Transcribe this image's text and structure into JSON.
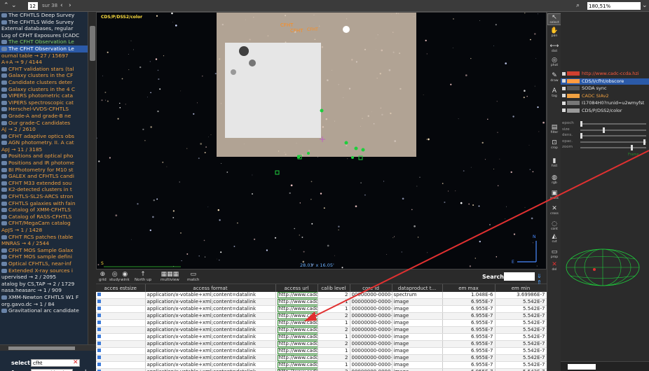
{
  "topbar": {
    "page": "12",
    "of_label": "sur 38",
    "zoom": "180,51%",
    "nav_icons": [
      "chevron-up",
      "chevron-down",
      "chevron-left",
      "chevron-right"
    ]
  },
  "tree": {
    "rows": [
      {
        "text": "The CFHTLS Deep Survey",
        "style": "t-white",
        "icon": true
      },
      {
        "text": "The CFHTLS Wide Survey",
        "style": "t-white",
        "icon": true
      },
      {
        "text": "External databases, regular",
        "style": "t-white",
        "icon": false
      },
      {
        "text": "Log of CFHT Exposures (CADC",
        "style": "t-white",
        "icon": false
      },
      {
        "text": "The CFHT Observation Le",
        "style": "t-green",
        "icon": true
      },
      {
        "text": "The CFHT Observation Le",
        "style": "t-sel",
        "icon": true
      },
      {
        "text": "ournal table → 27 / 15697",
        "style": "t-orange",
        "icon": false
      },
      {
        "text": "A+A → 9 / 4144",
        "style": "t-orange",
        "icon": false
      },
      {
        "text": "CFHT validation stars (tal",
        "style": "t-orange",
        "icon": true
      },
      {
        "text": "Galaxy clusters in the CF",
        "style": "t-orange",
        "icon": true
      },
      {
        "text": "Candidate clusters deter",
        "style": "t-orange",
        "icon": true
      },
      {
        "text": "Galaxy clusters in the 4 C",
        "style": "t-orange",
        "icon": true
      },
      {
        "text": "VIPERS photometric cata",
        "style": "t-orange",
        "icon": true
      },
      {
        "text": "VIPERS spectroscopic cat",
        "style": "t-orange",
        "icon": true
      },
      {
        "text": "Herschel-VVDS-CFHTLS",
        "style": "t-orange",
        "icon": true
      },
      {
        "text": "Grade-A and grade-B ne",
        "style": "t-orange",
        "icon": true
      },
      {
        "text": "Our grade-C candidates",
        "style": "t-orange",
        "icon": true
      },
      {
        "text": "AJ → 2 / 2610",
        "style": "t-orange",
        "icon": false
      },
      {
        "text": "CFHT adaptive optics obs",
        "style": "t-orange",
        "icon": true
      },
      {
        "text": "AGN photometry. II. A cat",
        "style": "t-orange",
        "icon": true
      },
      {
        "text": "ApJ → 11 / 3185",
        "style": "t-orange",
        "icon": false
      },
      {
        "text": "Positions and optical pho",
        "style": "t-orange",
        "icon": true
      },
      {
        "text": "Positions and IR photome",
        "style": "t-orange",
        "icon": true
      },
      {
        "text": "BI Photometry for M10 st",
        "style": "t-orange",
        "icon": true
      },
      {
        "text": "GALEX and CFHTLS candi",
        "style": "t-orange",
        "icon": true
      },
      {
        "text": "CFHT M33 extended sou",
        "style": "t-orange",
        "icon": true
      },
      {
        "text": "K2-detected clusters in t",
        "style": "t-orange",
        "icon": true
      },
      {
        "text": "CFHTLS-SL2S-ARCS stron",
        "style": "t-orange",
        "icon": true
      },
      {
        "text": "CFHTLS galaxies with fain",
        "style": "t-orange",
        "icon": true
      },
      {
        "text": "Catalog of XMM-CFHTLS",
        "style": "t-orange",
        "icon": true
      },
      {
        "text": "Catalog of RASS-CFHTLS",
        "style": "t-orange",
        "icon": true
      },
      {
        "text": "CFHT/MegaCam catalog",
        "style": "t-orange",
        "icon": true
      },
      {
        "text": "ApJS → 1 / 1428",
        "style": "t-orange",
        "icon": false
      },
      {
        "text": "CFHT RCS patches (table",
        "style": "t-orange",
        "icon": true
      },
      {
        "text": "MNRAS → 4 / 2544",
        "style": "t-orange",
        "icon": false
      },
      {
        "text": "CFHT MOS Sample Galax",
        "style": "t-orange",
        "icon": true
      },
      {
        "text": "CFHT MOS sample defini",
        "style": "t-orange",
        "icon": true
      },
      {
        "text": "Optical CFHTLS, near-inf",
        "style": "t-orange",
        "icon": true
      },
      {
        "text": "Extended X-ray sources i",
        "style": "t-orange",
        "icon": true
      },
      {
        "text": "upervised → 2 / 2095",
        "style": "t-white",
        "icon": false
      },
      {
        "text": "atalog by CS,TAP → 2 / 1729",
        "style": "t-white",
        "icon": false
      },
      {
        "text": "nasa.heasarc → 1 / 909",
        "style": "t-white",
        "icon": false
      },
      {
        "text": "XMM-Newton CFHTLS W1 F",
        "style": "t-white",
        "icon": true
      },
      {
        "text": "org.gavo.dc → 1 / 84",
        "style": "t-white",
        "icon": false
      },
      {
        "text": "Gravitational arc candidate",
        "style": "t-white",
        "icon": true
      }
    ]
  },
  "select_field": {
    "label": "select",
    "value": "cfht"
  },
  "from_field": {
    "label": "from",
    "value": "My working l..."
  },
  "view": {
    "survey_label": "CDS/P/DSS2/color",
    "fov_label": "28.03' x 16.05'",
    "corner_label": "S"
  },
  "bottom_toolbar": {
    "buttons": [
      {
        "name": "grid",
        "glyph": "⊕",
        "label": "grid"
      },
      {
        "name": "study",
        "glyph": "◎",
        "label": "study"
      },
      {
        "name": "wink",
        "glyph": "◉",
        "label": "wink"
      },
      {
        "name": "northup",
        "glyph": "↑",
        "label": "North up"
      },
      {
        "name": "multiview",
        "glyph": "▦▦▦",
        "label": "multiview"
      },
      {
        "name": "match",
        "glyph": "▭",
        "label": "match"
      }
    ],
    "search_label": "Search",
    "search_arrows": "⇓ ⇑"
  },
  "table": {
    "columns": [
      "acces estsize",
      "access format",
      "access url",
      "calib level",
      "core id",
      "dataproduct t...",
      "em max",
      "em min"
    ],
    "rows": [
      [
        "application/x-votable+xml;content=datalink",
        "http://www.cadc",
        "2",
        "00000000-0000-",
        "spectrum",
        "1.048E-6",
        "3.69986E-7"
      ],
      [
        "application/x-votable+xml;content=datalink",
        "http://www.cadc",
        "1",
        "00000000-0000-",
        "image",
        "6.955E-7",
        "5.542E-7"
      ],
      [
        "application/x-votable+xml;content=datalink",
        "http://www.cadc",
        "1",
        "00000000-0000-",
        "image",
        "6.955E-7",
        "5.542E-7"
      ],
      [
        "application/x-votable+xml;content=datalink",
        "http://www.cadc",
        "2",
        "00000000-0000-",
        "image",
        "6.955E-7",
        "5.542E-7"
      ],
      [
        "application/x-votable+xml;content=datalink",
        "http://www.cadc",
        "1",
        "00000000-0000-",
        "image",
        "6.955E-7",
        "5.542E-7"
      ],
      [
        "application/x-votable+xml;content=datalink",
        "http://www.cadc",
        "2",
        "00000000-0000-",
        "image",
        "6.955E-7",
        "5.542E-7"
      ],
      [
        "application/x-votable+xml;content=datalink",
        "http://www.cadc",
        "1",
        "00000000-0000-",
        "image",
        "6.955E-7",
        "5.542E-7"
      ],
      [
        "application/x-votable+xml;content=datalink",
        "http://www.cadc",
        "2",
        "00000000-0000-",
        "image",
        "6.955E-7",
        "5.542E-7"
      ],
      [
        "application/x-votable+xml;content=datalink",
        "http://www.cadc",
        "1",
        "00000000-0000-",
        "image",
        "6.955E-7",
        "5.542E-7"
      ],
      [
        "application/x-votable+xml;content=datalink",
        "http://www.cadc",
        "2",
        "00000000-0000-",
        "image",
        "6.955E-7",
        "5.542E-7"
      ],
      [
        "application/x-votable+xml;content=datalink",
        "http://www.cadc",
        "1",
        "00000000-0000-",
        "image",
        "6.955E-7",
        "5.542E-7"
      ],
      [
        "application/x-votable+xml;content=datalink",
        "http://www.cadc",
        "2",
        "00000000-0000-",
        "image",
        "6.955E-7",
        "5.542E-7"
      ],
      [
        "application/x-votable+xml;content=datalink",
        "http://www.cadc",
        "1",
        "00000000-0000-",
        "image",
        "6.955E-7",
        "5.542E-7"
      ]
    ]
  },
  "tools": [
    {
      "name": "select",
      "glyph": "↖",
      "label": "select",
      "selected": true
    },
    {
      "name": "pan",
      "glyph": "✋",
      "label": "pan"
    },
    {
      "name": "dist",
      "glyph": "⟷",
      "label": "dist"
    },
    {
      "name": "phot",
      "glyph": "◎",
      "label": "phot"
    },
    {
      "name": "draw",
      "glyph": "✎",
      "label": "draw"
    },
    {
      "name": "tag",
      "glyph": "A",
      "label": "tag"
    },
    {
      "name": "filter",
      "glyph": "▤",
      "label": "filter"
    },
    {
      "name": "crop",
      "glyph": "⊡",
      "label": "crop"
    },
    {
      "name": "hist",
      "glyph": "▮",
      "label": "hist"
    },
    {
      "name": "rgb",
      "glyph": "◍",
      "label": "rgb"
    },
    {
      "name": "assoc",
      "glyph": "▣",
      "label": "assoc"
    },
    {
      "name": "cross",
      "glyph": "✕",
      "label": "cross"
    },
    {
      "name": "cont",
      "glyph": "◌",
      "label": "cont"
    },
    {
      "name": "cut",
      "glyph": "◭",
      "label": "cut"
    },
    {
      "name": "prop",
      "glyph": "▭",
      "label": "prop"
    },
    {
      "name": "del",
      "glyph": "✕",
      "label": "del"
    }
  ],
  "layers": [
    {
      "text": "http://www.cadc-ccda.hzi",
      "color": "#ff5a3c",
      "swatch": "#d04030",
      "selected": false
    },
    {
      "text": "CDS/I/cfht/obscore",
      "color": "#ffffff",
      "swatch": "#ff9a40",
      "selected": true
    },
    {
      "text": "SODA sync",
      "color": "#e4e4e4",
      "swatch": "#555555",
      "selected": false
    },
    {
      "text": "CADC SIAv2",
      "color": "#f0a040",
      "swatch": "#f0a040",
      "selected": false
    },
    {
      "text": "I17084H0?runid=u2wmyfst",
      "color": "#e4e4e4",
      "swatch": "#777777",
      "selected": false
    },
    {
      "text": "CDS/P/DSS2/color",
      "color": "#e4e4e4",
      "swatch": "#999999",
      "selected": false
    }
  ],
  "sliders": [
    {
      "label": "epoch",
      "level": 0.0
    },
    {
      "label": "size",
      "level": 0.35
    },
    {
      "label": "dens.",
      "level": 0.0
    },
    {
      "label": "opac.",
      "level": 1.0
    },
    {
      "label": "zoom",
      "level": 0.8
    }
  ],
  "frame_label": "Frame",
  "colors": {
    "accent": "#2b5aa8",
    "orange": "#f0a040",
    "green": "#1ecf3c",
    "annotation": "#e03030"
  }
}
